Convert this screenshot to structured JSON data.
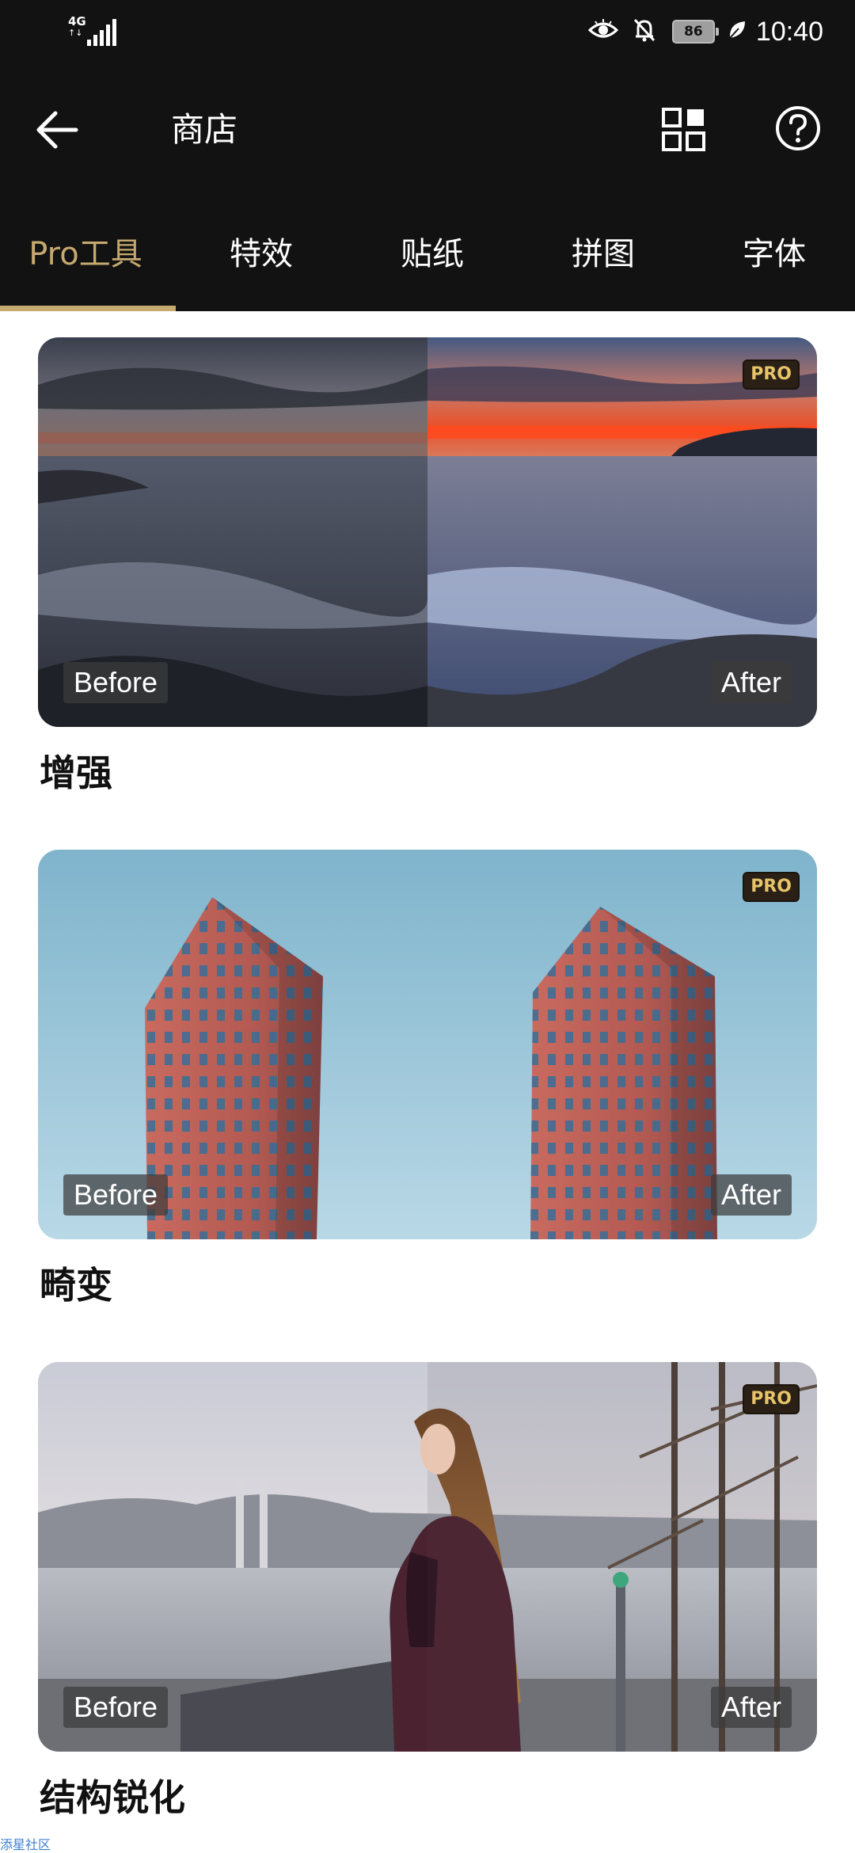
{
  "status_bar": {
    "network": "4G",
    "network_sub": "↑↓",
    "battery": "86",
    "time": "10:40"
  },
  "header": {
    "title": "商店"
  },
  "tabs": [
    {
      "label": "Pro工具",
      "active": true
    },
    {
      "label": "特效",
      "active": false
    },
    {
      "label": "贴纸",
      "active": false
    },
    {
      "label": "拼图",
      "active": false
    },
    {
      "label": "字体",
      "active": false
    }
  ],
  "cards": [
    {
      "title": "增强",
      "badge": "PRO",
      "before": "Before",
      "after": "After"
    },
    {
      "title": "畸变",
      "badge": "PRO",
      "before": "Before",
      "after": "After"
    },
    {
      "title": "结构锐化",
      "badge": "PRO",
      "before": "Before",
      "after": "After"
    }
  ],
  "watermark": "添星社区",
  "colors": {
    "bar_bg": "#121212",
    "accent": "#c6a96f",
    "badge_text": "#e7c36a"
  }
}
